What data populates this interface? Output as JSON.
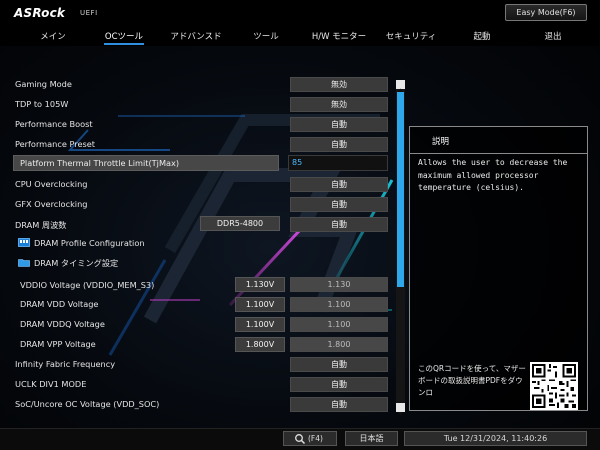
{
  "header": {
    "logo": "ASRock",
    "subtitle": "UEFI",
    "easy_mode_label": "Easy Mode(F6)"
  },
  "nav": {
    "tabs": [
      {
        "label": "メイン"
      },
      {
        "label": "OCツール",
        "active": true
      },
      {
        "label": "アドバンスド"
      },
      {
        "label": "ツール"
      },
      {
        "label": "H/W モニター"
      },
      {
        "label": "セキュリティ"
      },
      {
        "label": "起動"
      },
      {
        "label": "退出"
      }
    ]
  },
  "settings": {
    "gaming_mode": {
      "label": "Gaming Mode",
      "value": "無効"
    },
    "tdp": {
      "label": "TDP to 105W",
      "value": "無効"
    },
    "perf_boost": {
      "label": "Performance Boost",
      "value": "自動"
    },
    "perf_preset": {
      "label": "Performance Preset",
      "value": "自動"
    },
    "throttle": {
      "label": "Platform Thermal Throttle Limit(TjMax)",
      "value": "85"
    },
    "cpu_oc": {
      "label": "CPU Overclocking",
      "value": "自動"
    },
    "gfx_oc": {
      "label": "GFX Overclocking",
      "value": "自動"
    },
    "dram_freq": {
      "label": "DRAM 周波数",
      "current": "DDR5-4800",
      "value": "自動"
    },
    "dram_profile": {
      "label": "DRAM Profile Configuration"
    },
    "dram_timing": {
      "label": "DRAM タイミング設定"
    },
    "vddio": {
      "label": "VDDIO Voltage (VDDIO_MEM_S3)",
      "current": "1.130V",
      "value": "1.130"
    },
    "dram_vdd": {
      "label": "DRAM VDD Voltage",
      "current": "1.100V",
      "value": "1.100"
    },
    "dram_vddq": {
      "label": "DRAM VDDQ Voltage",
      "current": "1.100V",
      "value": "1.100"
    },
    "dram_vpp": {
      "label": "DRAM VPP Voltage",
      "current": "1.800V",
      "value": "1.800"
    },
    "if_freq": {
      "label": "Infinity Fabric Frequency",
      "value": "自動"
    },
    "uclk": {
      "label": "UCLK DIV1 MODE",
      "value": "自動"
    },
    "soc_volt": {
      "label": "SoC/Uncore OC Voltage (VDD_SOC)",
      "value": "自動"
    }
  },
  "help": {
    "title": "説明",
    "text": "Allows the user to decrease the maximum allowed processor temperature (celsius).",
    "qr_text": "このQRコードを使って、マザーボードの取扱説明書PDFをダウンロ"
  },
  "footer": {
    "search_label": "(F4)",
    "language": "日本語",
    "datetime": "Tue 12/31/2024, 11:40:26"
  },
  "colors": {
    "accent": "#2ea8ea",
    "button_bg": "#3a3a3a",
    "input_text": "#4fb8ff"
  },
  "icons": {
    "search": "search-icon",
    "dram_profile": "memory-module-icon",
    "dram_timing": "folder-icon",
    "scroll_up": "triangle-up-icon",
    "scroll_down": "triangle-down-icon"
  },
  "scrollbar": {
    "position_fraction": 0.0,
    "visible_fraction": 0.6
  }
}
